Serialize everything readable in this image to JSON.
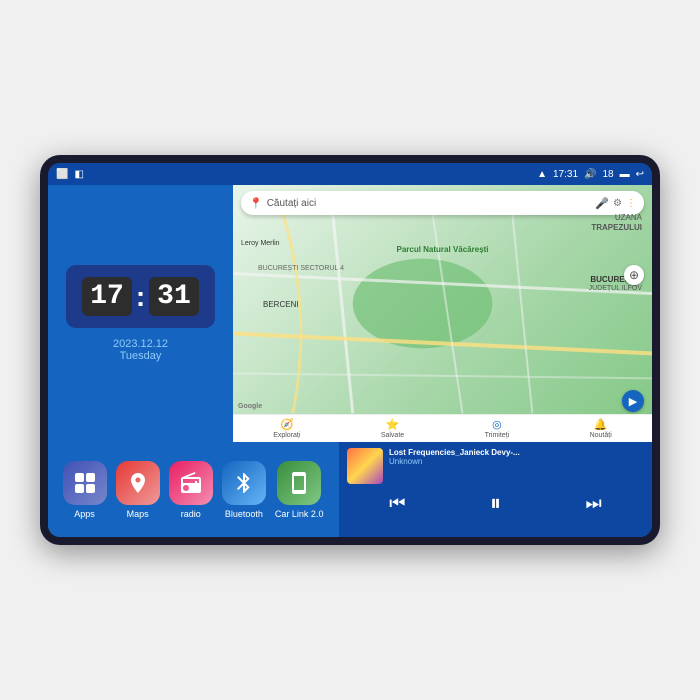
{
  "device": {
    "screen_bg": "#1565c0"
  },
  "status_bar": {
    "left_icons": [
      "home-icon",
      "nav-icon"
    ],
    "time": "17:31",
    "battery": "18",
    "right_icons": [
      "battery-icon",
      "back-icon"
    ]
  },
  "clock": {
    "hour": "17",
    "minute": "31",
    "date": "2023.12.12",
    "day": "Tuesday"
  },
  "map": {
    "search_placeholder": "Căutați aici",
    "labels": {
      "uzana": "UZANA",
      "trapezului": "TRAPEZULUI",
      "parcul": "Parcul Natural Văcărești",
      "bucuresti": "BUCUREȘTI",
      "judet_ilfov": "JUDEȚUL ILFOV",
      "berceni": "BERCENI",
      "sector4": "BUCUREȘTI SECTORUL 4",
      "leroy": "Leroy Merlin"
    },
    "bottom_items": [
      {
        "icon": "🧭",
        "label": "Explorați"
      },
      {
        "icon": "⭐",
        "label": "Salvate"
      },
      {
        "icon": "◎",
        "label": "Trimiteți"
      },
      {
        "icon": "🔔",
        "label": "Noutăți"
      }
    ]
  },
  "apps": [
    {
      "id": "apps",
      "label": "Apps",
      "icon": "⊞",
      "bg_class": "app-icon-apps"
    },
    {
      "id": "maps",
      "label": "Maps",
      "icon": "📍",
      "bg_class": "app-icon-maps"
    },
    {
      "id": "radio",
      "label": "radio",
      "icon": "📻",
      "bg_class": "app-icon-radio"
    },
    {
      "id": "bluetooth",
      "label": "Bluetooth",
      "icon": "🔷",
      "bg_class": "app-icon-bluetooth"
    },
    {
      "id": "carlink",
      "label": "Car Link 2.0",
      "icon": "📱",
      "bg_class": "app-icon-carlink"
    }
  ],
  "music": {
    "title": "Lost Frequencies_Janieck Devy-...",
    "artist": "Unknown",
    "controls": {
      "prev": "⏮",
      "play": "⏸",
      "next": "⏭"
    }
  }
}
